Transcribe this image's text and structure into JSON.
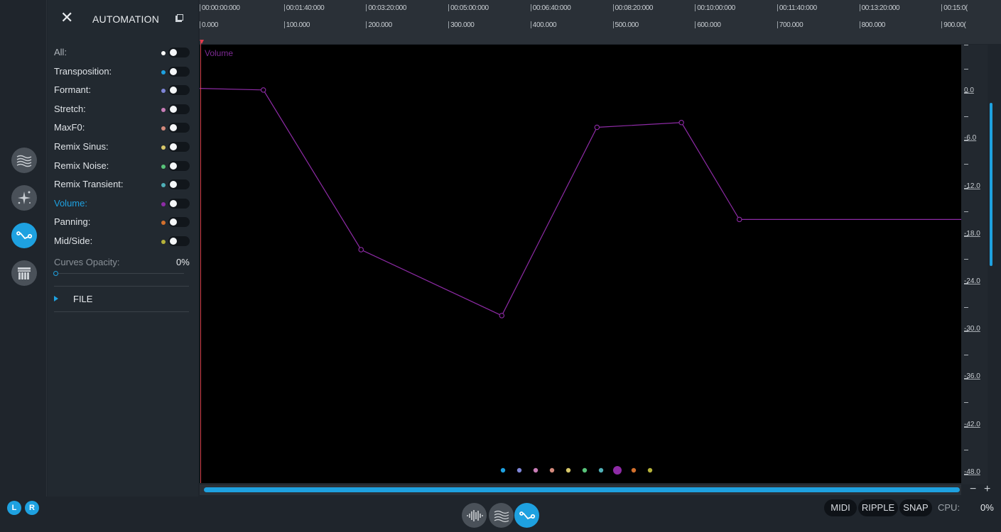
{
  "panel": {
    "title": "AUTOMATION",
    "close_icon": "close-icon",
    "copy_icon": "copy-icon",
    "rows": [
      {
        "label": "All:",
        "dot": "#ffffff",
        "state": "normal"
      },
      {
        "label": "Transposition:",
        "dot": "#1ea1e0",
        "state": "normal"
      },
      {
        "label": "Formant:",
        "dot": "#7f86d8",
        "state": "normal"
      },
      {
        "label": "Stretch:",
        "dot": "#c97db7",
        "state": "normal"
      },
      {
        "label": "MaxF0:",
        "dot": "#d48a7c",
        "state": "normal"
      },
      {
        "label": "Remix Sinus:",
        "dot": "#d8c86a",
        "state": "normal"
      },
      {
        "label": "Remix Noise:",
        "dot": "#58c47a",
        "state": "normal"
      },
      {
        "label": "Remix Transient:",
        "dot": "#4fb0b8",
        "state": "normal"
      },
      {
        "label": "Volume:",
        "dot": "#8e2ba6",
        "state": "active"
      },
      {
        "label": "Panning:",
        "dot": "#d3702d",
        "state": "normal"
      },
      {
        "label": "Mid/Side:",
        "dot": "#b6b23a",
        "state": "normal"
      }
    ],
    "curves_opacity_label": "Curves Opacity:",
    "curves_opacity_value": "0%",
    "curves_opacity_fraction": 0.0,
    "file_label": "FILE"
  },
  "ruler": {
    "time_labels": [
      "00:00:00:000",
      "00:01:40:000",
      "00:03:20:000",
      "00:05:00:000",
      "00:06:40:000",
      "00:08:20:000",
      "00:10:00:000",
      "00:11:40:000",
      "00:13:20:000",
      "00:15:0("
    ],
    "frame_labels": [
      "0.000",
      "100.000",
      "200.000",
      "300.000",
      "400.000",
      "500.000",
      "600.000",
      "700.000",
      "800.000",
      "900.00("
    ]
  },
  "graph": {
    "curve_label": "Volume",
    "curve_color": "#8e2ba6",
    "db_labels": [
      "0.0",
      "-6.0",
      "-12.0",
      "-18.0",
      "-24.0",
      "-30.0",
      "-36.0",
      "-42.0",
      "-48.0"
    ],
    "param_dots": [
      {
        "color": "#1ea1e0",
        "selected": false
      },
      {
        "color": "#7f86d8",
        "selected": false
      },
      {
        "color": "#c97db7",
        "selected": false
      },
      {
        "color": "#d48a7c",
        "selected": false
      },
      {
        "color": "#d8c86a",
        "selected": false
      },
      {
        "color": "#58c47a",
        "selected": false
      },
      {
        "color": "#4fb0b8",
        "selected": false
      },
      {
        "color": "#8e2ba6",
        "selected": true
      },
      {
        "color": "#d3702d",
        "selected": false
      },
      {
        "color": "#b6b23a",
        "selected": false
      }
    ]
  },
  "chart_data": {
    "type": "line",
    "x_unit": "frames",
    "y_unit": "dB",
    "ylim": [
      -48,
      6
    ],
    "xlim": [
      0,
      920
    ],
    "series": [
      {
        "name": "Volume",
        "x": [
          0,
          77,
          195,
          365,
          480,
          582,
          652,
          920
        ],
        "y": [
          0.5,
          0.3,
          -19.8,
          -28.1,
          -4.4,
          -3.8,
          -16.0,
          -16.0
        ]
      }
    ]
  },
  "rail": {
    "buttons": [
      {
        "name": "spectrum-mode-icon",
        "active": false
      },
      {
        "name": "sparkle-mode-icon",
        "active": false
      },
      {
        "name": "automation-mode-icon",
        "active": true
      },
      {
        "name": "layers-mode-icon",
        "active": false
      }
    ]
  },
  "bottom": {
    "left_label": "L",
    "right_label": "R",
    "midi": "MIDI",
    "ripple": "RIPPLE",
    "snap": "SNAP",
    "cpu_label": "CPU:",
    "cpu_value": "0%",
    "zoom_minus": "−",
    "zoom_plus": "+"
  }
}
